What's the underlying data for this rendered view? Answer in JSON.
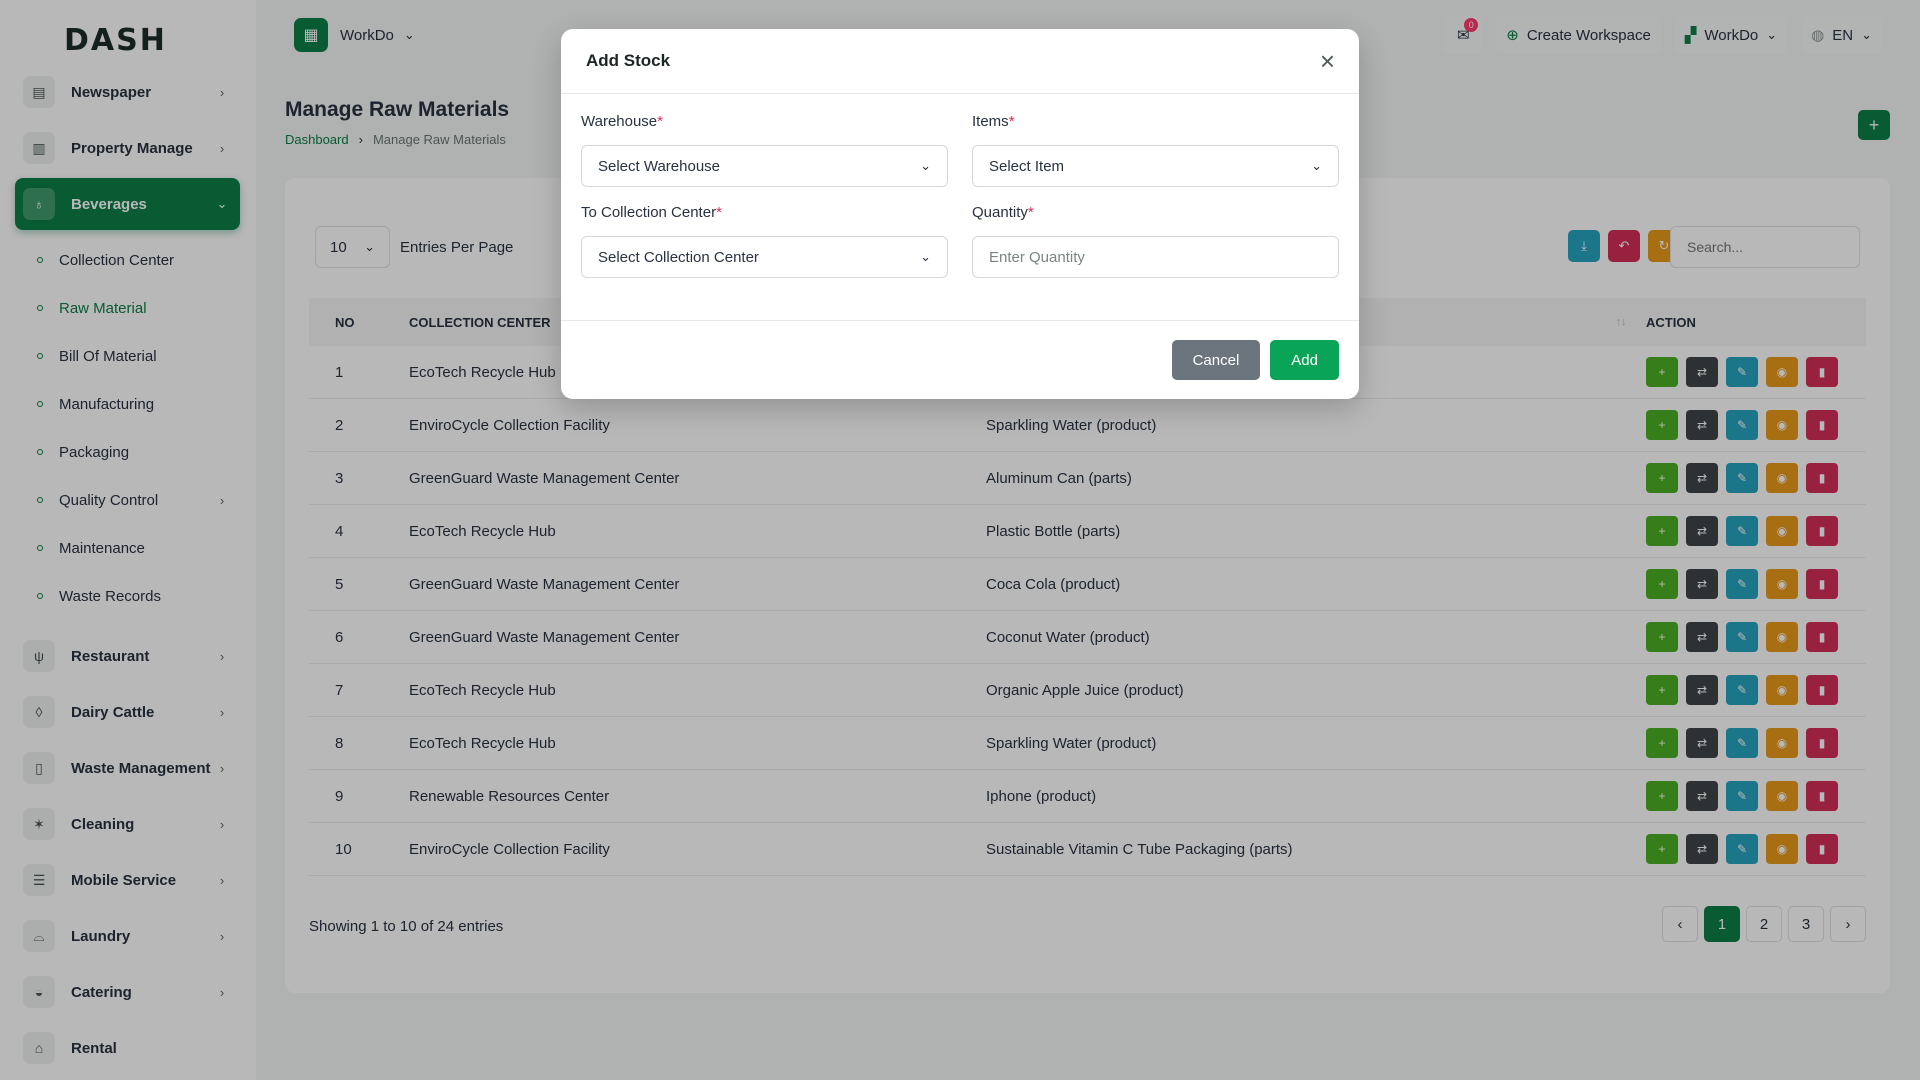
{
  "brand": {
    "logo_text": "DASH"
  },
  "sidebar": {
    "items_top": [
      {
        "label": "Newspaper",
        "icon": "newspaper-icon"
      },
      {
        "label": "Property Manage",
        "icon": "building-icon"
      }
    ],
    "active": {
      "label": "Beverages",
      "icon": "cup-icon"
    },
    "sub_items": [
      {
        "label": "Collection Center",
        "has_chevron": false
      },
      {
        "label": "Raw Material",
        "has_chevron": false,
        "active": true
      },
      {
        "label": "Bill Of Material",
        "has_chevron": false
      },
      {
        "label": "Manufacturing",
        "has_chevron": false
      },
      {
        "label": "Packaging",
        "has_chevron": false
      },
      {
        "label": "Quality Control",
        "has_chevron": true
      },
      {
        "label": "Maintenance",
        "has_chevron": false
      },
      {
        "label": "Waste Records",
        "has_chevron": false
      }
    ],
    "items_bottom": [
      {
        "label": "Restaurant",
        "icon": "utensils-icon",
        "has_chevron": true
      },
      {
        "label": "Dairy Cattle",
        "icon": "bottle-icon",
        "has_chevron": true
      },
      {
        "label": "Waste Management",
        "icon": "trash-icon",
        "has_chevron": true
      },
      {
        "label": "Cleaning",
        "icon": "sparkle-icon",
        "has_chevron": true
      },
      {
        "label": "Mobile Service",
        "icon": "lines-icon",
        "has_chevron": true
      },
      {
        "label": "Laundry",
        "icon": "shirt-icon",
        "has_chevron": true
      },
      {
        "label": "Catering",
        "icon": "pot-icon",
        "has_chevron": true
      },
      {
        "label": "Rental",
        "icon": "home-icon",
        "has_chevron": false
      }
    ]
  },
  "topbar": {
    "workspace_name": "WorkDo",
    "notification_count": "0",
    "create_workspace": "Create Workspace",
    "workspace_switch": "WorkDo",
    "language": "EN"
  },
  "page": {
    "title": "Manage Raw Materials",
    "breadcrumb": [
      "Dashboard",
      "Manage Raw Materials"
    ]
  },
  "list": {
    "entries_value": "10",
    "entries_label": "Entries Per Page",
    "search_placeholder": "Search...",
    "columns": {
      "no": "NO",
      "collection_center": "COLLECTION CENTER",
      "action": "ACTION",
      "sort_icon": "↑↓"
    },
    "rows": [
      {
        "no": "1",
        "center": "EcoTech Recycle Hub",
        "item": ""
      },
      {
        "no": "2",
        "center": "EnviroCycle Collection Facility",
        "item": "Sparkling Water (product)"
      },
      {
        "no": "3",
        "center": "GreenGuard Waste Management Center",
        "item": "Aluminum Can (parts)"
      },
      {
        "no": "4",
        "center": "EcoTech Recycle Hub",
        "item": "Plastic Bottle (parts)"
      },
      {
        "no": "5",
        "center": "GreenGuard Waste Management Center",
        "item": "Coca Cola (product)"
      },
      {
        "no": "6",
        "center": "GreenGuard Waste Management Center",
        "item": "Coconut Water (product)"
      },
      {
        "no": "7",
        "center": "EcoTech Recycle Hub",
        "item": "Organic Apple Juice (product)"
      },
      {
        "no": "8",
        "center": "EcoTech Recycle Hub",
        "item": "Sparkling Water (product)"
      },
      {
        "no": "9",
        "center": "Renewable Resources Center",
        "item": "Iphone (product)"
      },
      {
        "no": "10",
        "center": "EnviroCycle Collection Facility",
        "item": "Sustainable Vitamin C Tube Packaging (parts)"
      }
    ],
    "showing": "Showing 1 to 10 of 24 entries",
    "pages": [
      "1",
      "2",
      "3"
    ]
  },
  "modal": {
    "title": "Add Stock",
    "warehouse": {
      "label": "Warehouse",
      "value": "Select Warehouse"
    },
    "items": {
      "label": "Items",
      "value": "Select Item"
    },
    "collection_center": {
      "label": "To Collection Center",
      "value": "Select Collection Center"
    },
    "quantity": {
      "label": "Quantity",
      "placeholder": "Enter Quantity"
    },
    "required_mark": "*",
    "cancel": "Cancel",
    "add": "Add"
  },
  "colors": {
    "primary": "#0c7e46",
    "add_btn": "#0aa458",
    "cancel_btn": "#6c757d",
    "act_green": "#4caf24",
    "act_dark": "#404547",
    "act_teal": "#28a4bf",
    "act_orange": "#e8991a",
    "act_red": "#d32f59"
  }
}
